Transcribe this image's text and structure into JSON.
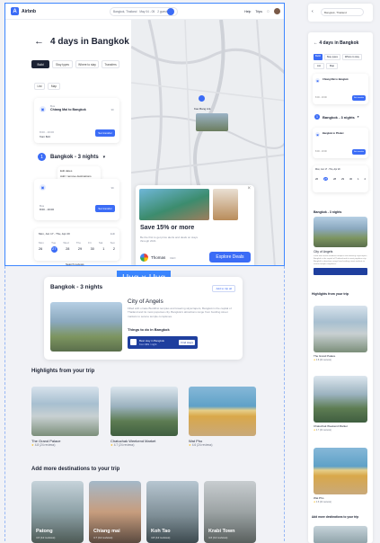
{
  "app": {
    "logo_letter": "A",
    "name": "Airbnb"
  },
  "topbar": {
    "location": "Bangkok, Thailand",
    "dates": "May 04 - 05",
    "guests": "2 guests",
    "nav_items": [
      "Help",
      "Trips"
    ]
  },
  "page": {
    "title": "4 days in Bangkok"
  },
  "chips": [
    "Build",
    "Stay types",
    "Where to stay",
    "Transfers"
  ],
  "view_toggles": [
    "List",
    "Map"
  ],
  "transfer_card": {
    "label": "Bus",
    "from_to": "Chiang Mai to Bangkok",
    "time": "8:00 - 19:00",
    "price": "from $14",
    "tag": "9h",
    "button": "Set transfer"
  },
  "stay_selector": {
    "number": "1",
    "label": "Bangkok - 3 nights",
    "menu": [
      "Edit dates",
      "Add / remove destinations",
      "Get trip by vacation"
    ]
  },
  "transfer_card_2": {
    "label": "Bus",
    "from_to": "Bangkok to Phuket",
    "time": "8:00 - 19:00",
    "price": "from $14",
    "button": "Set transfer",
    "tag": "9h"
  },
  "calendar": {
    "title": "Mon, Jun 17 - Thu, Apr 20",
    "days": [
      "Mon",
      "Tue",
      "Wed",
      "Thu",
      "Fri",
      "Sat",
      "Sun"
    ],
    "dates": [
      "26",
      "27",
      "28",
      "29",
      "30",
      "1",
      "2"
    ],
    "selected": "27",
    "footer": "Search reviews"
  },
  "map": {
    "pin_label": "Kao Bang Ant",
    "close_icon": "×"
  },
  "promo": {
    "title": "Save 15% or more",
    "body": "Be the first to get price alerts and deals on stays through 2021",
    "author": "Thomas",
    "role": "CEO",
    "button": "Explore Deals"
  },
  "hug_label": "Hug × Hug",
  "city_card": {
    "header": "Bangkok - 3 nights",
    "tag": "Add to trip all",
    "name": "City of Angels",
    "desc": "Filled with ornate Buddhist temples and towering skyscrapers, Bangkok is the capital of Thailand and its most populous city. Bangkok's attractions range from bustling street markets to serene temple complexes.",
    "things_title": "Things to do in Bangkok",
    "stay_text": "Best stay in Bangkok",
    "stay_sub": "from $69 / night",
    "stay_button": "Find stays"
  },
  "highlights": {
    "title": "Highlights from your trip",
    "items": [
      {
        "name": "The Grand Palace",
        "rating": "4.8 (24 reviews)"
      },
      {
        "name": "Chatuchak Weekend Market",
        "rating": "4.7 (24 reviews)"
      },
      {
        "name": "Wat Pho",
        "rating": "4.6 (24 reviews)"
      }
    ]
  },
  "destinations": {
    "title": "Add more destinations to your trip",
    "items": [
      {
        "name": "Patong",
        "rating": "4.6 (12 reviews)"
      },
      {
        "name": "Chiang mai",
        "rating": "4.7 (12 reviews)"
      },
      {
        "name": "Koh Tao",
        "rating": "4.8 (12 reviews)"
      },
      {
        "name": "Krabi Town",
        "rating": "4.6 (12 reviews)"
      }
    ]
  },
  "mobile": {
    "title": "4 days in Bangkok",
    "stay": "Bangkok - 3 nights",
    "city_title": "City of Angels",
    "highlights_title": "Highlights from your trip",
    "dest_title": "Add more destinations to your trip",
    "items": [
      "The Grand Palace",
      "Chatuchak Weekend Market",
      "Wat Pho"
    ],
    "search": "Bangkok, Thailand"
  },
  "colors": {
    "accent": "#3b6cf6",
    "selection": "#3d86ff",
    "dark": "#1c2233"
  }
}
